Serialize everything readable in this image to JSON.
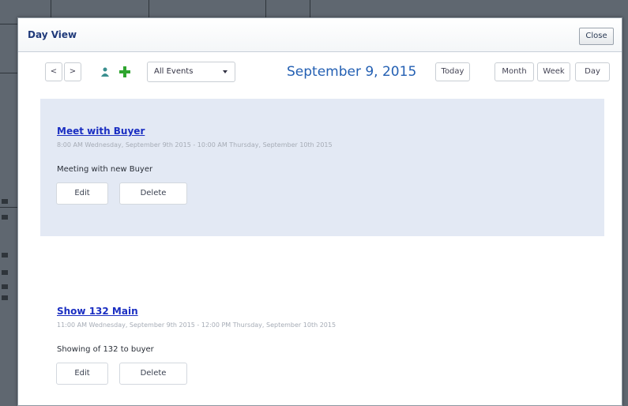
{
  "modal": {
    "title": "Day View",
    "close_label": "Close"
  },
  "toolbar": {
    "prev_label": "<",
    "next_label": ">",
    "filter_value": "All Events",
    "date_heading": "September 9, 2015",
    "today_label": "Today",
    "month_label": "Month",
    "week_label": "Week",
    "day_label": "Day"
  },
  "events": [
    {
      "title": "Meet with Buyer",
      "time": "8:00 AM Wednesday, September 9th 2015 - 10:00 AM Thursday, September 10th 2015",
      "description": "Meeting with new Buyer",
      "edit_label": "Edit",
      "delete_label": "Delete"
    },
    {
      "title": "Show 132 Main",
      "time": "11:00 AM Wednesday, September 9th 2015 - 12:00 PM Thursday, September 10th 2015",
      "description": "Showing of 132 to buyer",
      "edit_label": "Edit",
      "delete_label": "Delete"
    }
  ],
  "colors": {
    "accent_green": "#2fa52f",
    "link_blue": "#1b2fc2",
    "heading_blue": "#2460b3",
    "highlight_bg": "#e3e9f4"
  }
}
